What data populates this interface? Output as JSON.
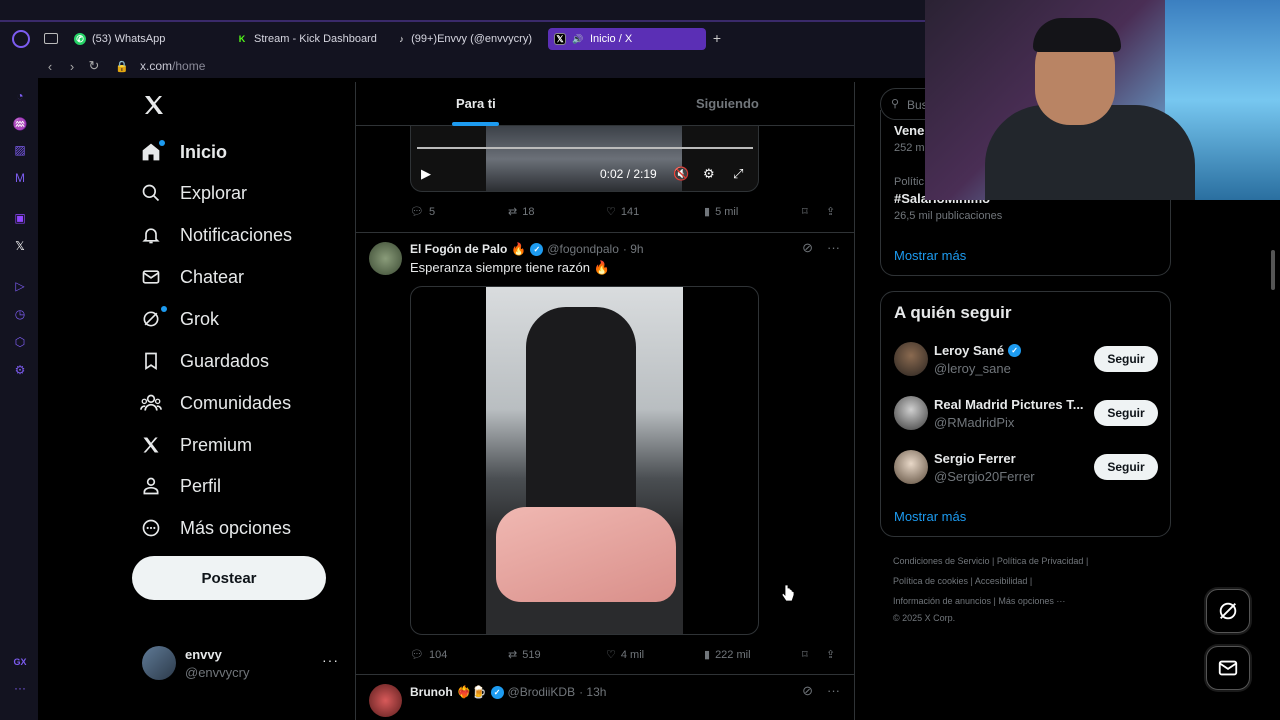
{
  "browser": {
    "tabs": [
      {
        "label": "(53) WhatsApp",
        "icon": "whatsapp-icon",
        "color": "#25d366"
      },
      {
        "label": "Stream - Kick Dashboard",
        "icon": "kick-icon",
        "color": "#53fc18"
      },
      {
        "label": "(99+)Envvy (@envvycry)",
        "icon": "tiktok-icon",
        "color": "#ffffff"
      },
      {
        "label": "Inicio / X",
        "icon": "x-icon",
        "color": "#ffffff"
      }
    ],
    "url_host": "x.com",
    "url_path": "/home"
  },
  "xnav": {
    "items": [
      {
        "label": "Inicio",
        "icon": "home-icon"
      },
      {
        "label": "Explorar",
        "icon": "search-icon"
      },
      {
        "label": "Notificaciones",
        "icon": "bell-icon"
      },
      {
        "label": "Chatear",
        "icon": "mail-icon"
      },
      {
        "label": "Grok",
        "icon": "grok-icon"
      },
      {
        "label": "Guardados",
        "icon": "bookmark-icon"
      },
      {
        "label": "Comunidades",
        "icon": "communities-icon"
      },
      {
        "label": "Premium",
        "icon": "x-icon"
      },
      {
        "label": "Perfil",
        "icon": "person-icon"
      },
      {
        "label": "Más opciones",
        "icon": "more-circle-icon"
      }
    ],
    "post_label": "Postear",
    "account": {
      "name": "envvy",
      "handle": "@envvycry",
      "more": "···"
    }
  },
  "feed": {
    "tabs": {
      "for_you": "Para ti",
      "following": "Siguiendo"
    },
    "video1": {
      "time": "0:02 / 2:19"
    },
    "tweet1_actions": {
      "replies": "5",
      "reposts": "18",
      "likes": "141",
      "views": "5 mil"
    },
    "tweet2": {
      "name": "El Fogón de Palo",
      "emoji": "🔥",
      "handle": "@fogondpalo",
      "time": "· 9h",
      "text": "Esperanza siempre tiene razón 🔥",
      "actions": {
        "replies": "104",
        "reposts": "519",
        "likes": "4 mil",
        "views": "222 mil"
      }
    },
    "tweet3": {
      "name": "Brunoh",
      "emoji": "❤️‍🔥🍺",
      "handle": "@BrodiiKDB",
      "time": "· 13h"
    }
  },
  "right": {
    "search_placeholder": "Bus",
    "trends": {
      "t1_name": "Vene",
      "t1_count": "252 m",
      "t2_category": "Polític",
      "t2_name": "#SalarioMinimo",
      "t2_count": "26,5 mil publicaciones",
      "show_more": "Mostrar más"
    },
    "who_to_follow": {
      "title": "A quién seguir",
      "follow_label": "Seguir",
      "people": [
        {
          "name": "Leroy Sané",
          "handle": "@leroy_sane",
          "verified": true
        },
        {
          "name": "Real Madrid Pictures T...",
          "handle": "@RMadridPix",
          "verified": false
        },
        {
          "name": "Sergio Ferrer",
          "handle": "@Sergio20Ferrer",
          "verified": false
        }
      ],
      "show_more": "Mostrar más"
    },
    "footer": {
      "line1": "Condiciones de Servicio  |   Política de Privacidad  |",
      "line2": "Política de cookies  |   Accesibilidad  |",
      "line3": "Información de anuncios  |   Más opciones ···",
      "line4": "© 2025 X Corp."
    }
  },
  "opera_sidebar": {
    "gx_label": "GX",
    "more": "···"
  }
}
